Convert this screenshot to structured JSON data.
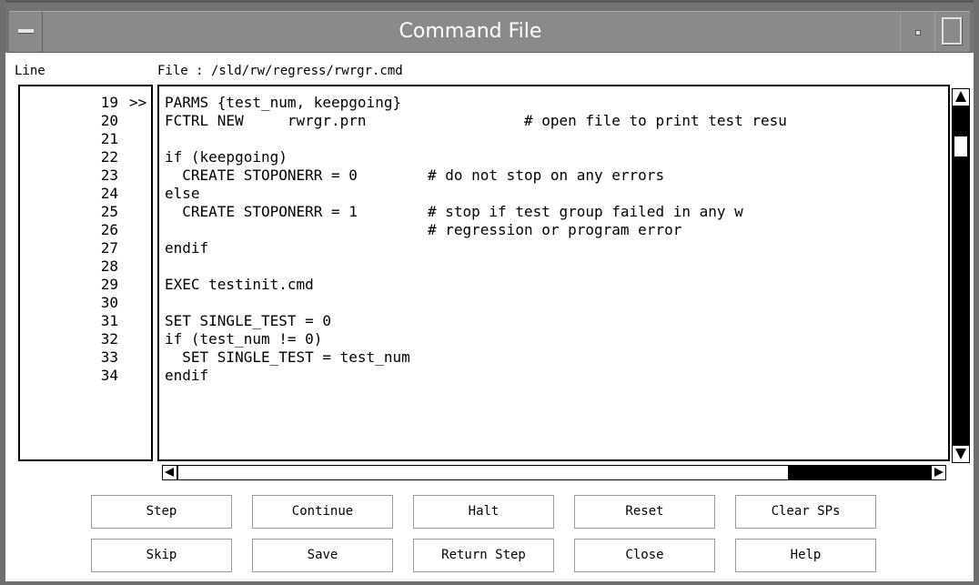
{
  "window": {
    "title": "Command File"
  },
  "header": {
    "line_label": "Line",
    "file_label": "File : /sld/rw/regress/rwrgr.cmd"
  },
  "current_line_marker": ">>",
  "lines": [
    {
      "num": "19",
      "code": "PARMS {test_num, keepgoing}"
    },
    {
      "num": "20",
      "code": "FCTRL NEW     rwrgr.prn                  # open file to print test resu"
    },
    {
      "num": "21",
      "code": ""
    },
    {
      "num": "22",
      "code": "if (keepgoing)"
    },
    {
      "num": "23",
      "code": "  CREATE STOPONERR = 0        # do not stop on any errors"
    },
    {
      "num": "24",
      "code": "else"
    },
    {
      "num": "25",
      "code": "  CREATE STOPONERR = 1        # stop if test group failed in any w"
    },
    {
      "num": "26",
      "code": "                              # regression or program error"
    },
    {
      "num": "27",
      "code": "endif"
    },
    {
      "num": "28",
      "code": ""
    },
    {
      "num": "29",
      "code": "EXEC testinit.cmd"
    },
    {
      "num": "30",
      "code": ""
    },
    {
      "num": "31",
      "code": "SET SINGLE_TEST = 0"
    },
    {
      "num": "32",
      "code": "if (test_num != 0)"
    },
    {
      "num": "33",
      "code": "  SET SINGLE_TEST = test_num"
    },
    {
      "num": "34",
      "code": "endif"
    }
  ],
  "buttons": {
    "step": "Step",
    "continue": "Continue",
    "halt": "Halt",
    "reset": "Reset",
    "clear_sps": "Clear SPs",
    "skip": "Skip",
    "save": "Save",
    "return_step": "Return Step",
    "close": "Close",
    "help": "Help"
  }
}
